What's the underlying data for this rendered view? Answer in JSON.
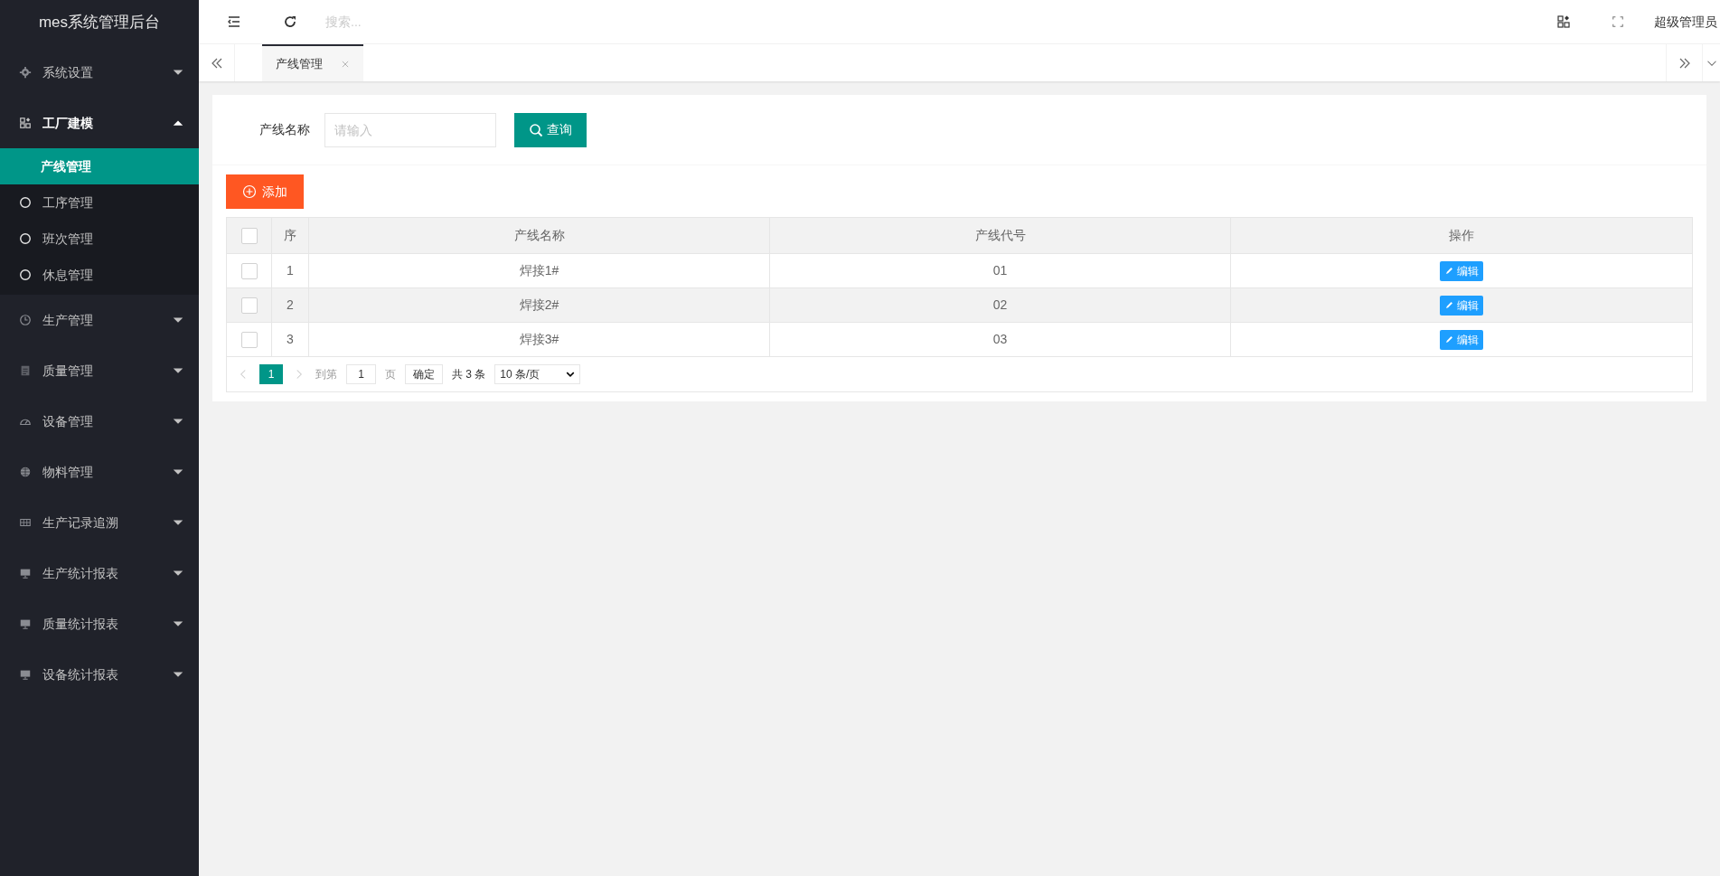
{
  "app_title": "mes系统管理后台",
  "sidebar": {
    "items": [
      {
        "label": "系统设置",
        "expanded": false
      },
      {
        "label": "工厂建模",
        "expanded": true,
        "children": [
          {
            "label": "产线管理",
            "selected": true
          },
          {
            "label": "工序管理",
            "selected": false
          },
          {
            "label": "班次管理",
            "selected": false
          },
          {
            "label": "休息管理",
            "selected": false
          }
        ]
      },
      {
        "label": "生产管理",
        "expanded": false
      },
      {
        "label": "质量管理",
        "expanded": false
      },
      {
        "label": "设备管理",
        "expanded": false
      },
      {
        "label": "物料管理",
        "expanded": false
      },
      {
        "label": "生产记录追溯",
        "expanded": false
      },
      {
        "label": "生产统计报表",
        "expanded": false
      },
      {
        "label": "质量统计报表",
        "expanded": false
      },
      {
        "label": "设备统计报表",
        "expanded": false
      }
    ]
  },
  "header": {
    "search_placeholder": "搜索...",
    "user": "超级管理员"
  },
  "tabs": [
    {
      "label": "产线管理",
      "selected": true
    }
  ],
  "filter": {
    "label": "产线名称",
    "placeholder": "请输入",
    "button": "查询"
  },
  "add_button": "添加",
  "table": {
    "select_all_checked": false,
    "columns": [
      "序",
      "产线名称",
      "产线代号",
      "操作"
    ],
    "rows": [
      {
        "index": "1",
        "name": "焊接1#",
        "code": "01",
        "action": "编辑",
        "checked": false
      },
      {
        "index": "2",
        "name": "焊接2#",
        "code": "02",
        "action": "编辑",
        "checked": false
      },
      {
        "index": "3",
        "name": "焊接3#",
        "code": "03",
        "action": "编辑",
        "checked": false
      }
    ]
  },
  "pagination": {
    "current": "1",
    "goto_label": "到第",
    "goto_value": "1",
    "page_label": "页",
    "confirm": "确定",
    "total": "共 3 条",
    "page_size": "10 条/页"
  }
}
